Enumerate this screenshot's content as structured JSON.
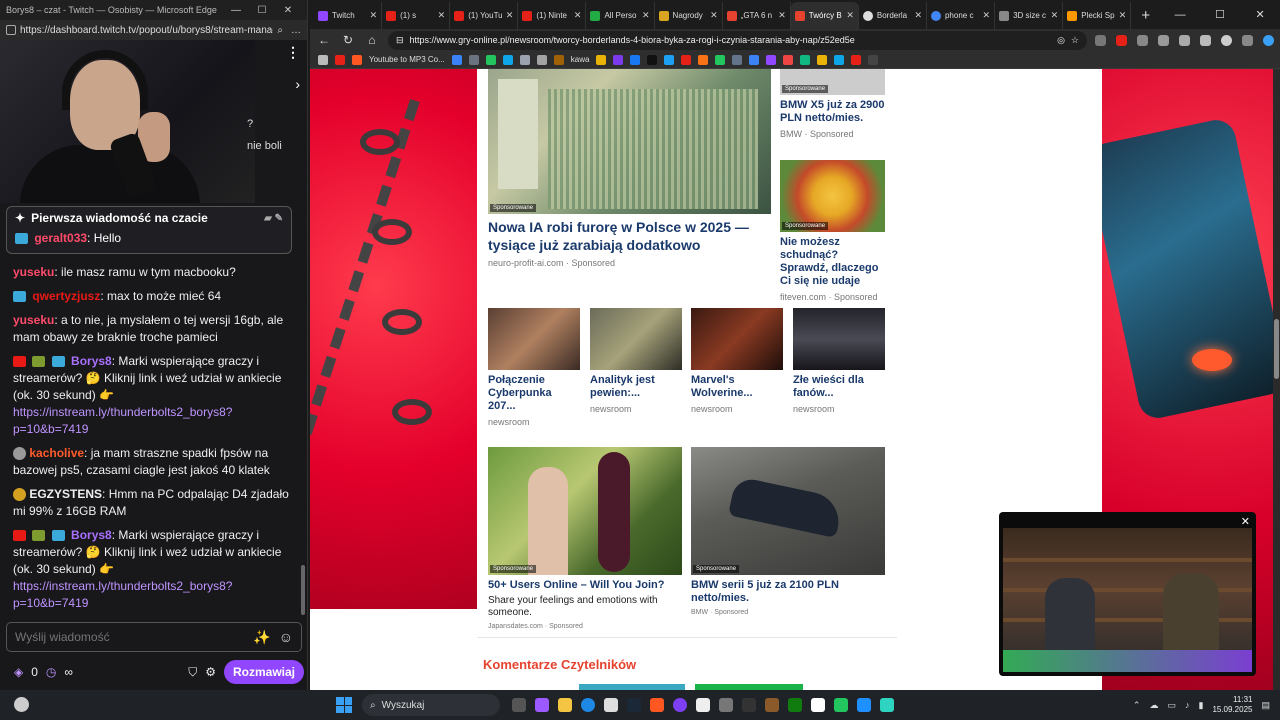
{
  "chat_window": {
    "title": "Borys8 – czat - Twitch — Osobisty — Microsoft Edge",
    "url": "https://dashboard.twitch.tv/popout/u/borys8/stream-manag...",
    "stream_snippet": {
      "line1": "?",
      "line2": "nie boli"
    },
    "pinned": {
      "header": "Pierwsza wiadomość na czacie",
      "user": "geralt033",
      "text": "Hello"
    },
    "messages": [
      {
        "user": "yuseku",
        "color": "#ff4a6a",
        "text": "ile masz ramu w tym macbooku?"
      },
      {
        "user": "qwertyzjusz",
        "color": "#e91916",
        "text": "max to może mieć 64"
      },
      {
        "user": "yuseku",
        "color": "#ff4a6a",
        "text": "a to nie, ja myslałem o tej wersji 16gb, ale mam obawy ze braknie troche pamieci"
      },
      {
        "user": "Borys8",
        "color": "#a970ff",
        "text": "Marki wspierające graczy i streamerów? 🤔 Kliknij link i weź udział w ankiecie (ok. 30 sekund) 👉",
        "link": "https://instream.ly/thunderbolts2_borys8?p=10&b=7419"
      },
      {
        "user": "kacholive",
        "color": "#ff5a2a",
        "text": "ja mam straszne spadki fpsów na bazowej ps5, czasami ciagle jest jakoś 40 klatek"
      },
      {
        "user": "EGZYSTENS",
        "color": "#efeff1",
        "text": "Hmm na PC odpalając D4 zjadało mi 99% z 16GB RAM"
      },
      {
        "user": "Borys8",
        "color": "#a970ff",
        "text": "Marki wspierające graczy i streamerów? 🤔 Kliknij link i weź udział w ankiecie (ok. 30 sekund) 👉",
        "link": "https://instream.ly/thunderbolts2_borys8?p=10&b=7419"
      }
    ],
    "input_placeholder": "Wyślij wiadomość",
    "points": "0",
    "infinity": "∞",
    "send_label": "Rozmawiaj"
  },
  "browser": {
    "tabs": [
      {
        "label": "Twitch",
        "color": "#9147ff"
      },
      {
        "label": "(1) s",
        "color": "#e62117"
      },
      {
        "label": "(1) YouTube",
        "color": "#e62117"
      },
      {
        "label": "(1) Ninte",
        "color": "#e62117"
      },
      {
        "label": "All Perso",
        "color": "#22aa44"
      },
      {
        "label": "Nagrody",
        "color": "#d9a520"
      },
      {
        "label": "„GTA 6 n",
        "color": "#e5432f"
      },
      {
        "label": "Twórcy B",
        "color": "#e5432f",
        "active": true
      },
      {
        "label": "Borderla",
        "color": "#dddddd"
      },
      {
        "label": "phone c",
        "color": "#4285f4"
      },
      {
        "label": "3D size c",
        "color": "#888888"
      },
      {
        "label": "Plecki Sp",
        "color": "#ff9900"
      }
    ],
    "url": "https://www.gry-online.pl/newsroom/tworcy-borderlands-4-biora-byka-za-rogi-i-czynia-starania-aby-nap/z52ed5e",
    "bookmark_label": "Youtube to MP3 Co...",
    "bookmark_label2": "kawa"
  },
  "page": {
    "sponsored_tag": "Sponsorowane",
    "cards": {
      "main": {
        "title": "Nowa IA robi furorę w Polsce w 2025 — tysiące już zarabiają dodatkowo",
        "source": "neuro-profit-ai.com · Sponsored"
      },
      "bmw_x5": {
        "title": "BMW X5 już za 2900 PLN netto/mies.",
        "source": "BMW · Sponsored"
      },
      "food": {
        "title": "Nie możesz schudnąć? Sprawdź, dlaczego Ci się nie udaje",
        "source": "fiteven.com · Sponsored"
      },
      "n1": {
        "title": "Połączenie Cyberpunka 207...",
        "source": "newsroom"
      },
      "n2": {
        "title": "Analityk jest pewien:...",
        "source": "newsroom"
      },
      "n3": {
        "title": "Marvel's Wolverine...",
        "source": "newsroom"
      },
      "n4": {
        "title": "Złe wieści dla fanów...",
        "source": "newsroom"
      },
      "users": {
        "title": "50+ Users Online – Will You Join?",
        "desc": "Share your feelings and emotions with someone.",
        "source": "Japansdates.com · Sponsored"
      },
      "bmw5": {
        "title": "BMW serii 5 już za 2100 PLN netto/mies.",
        "source": "BMW · Sponsored"
      }
    },
    "comments_heading": "Komentarze Czytelników"
  },
  "taskbar": {
    "search_placeholder": "Wyszukaj",
    "time": "11:31",
    "date": "15.09.2025"
  }
}
